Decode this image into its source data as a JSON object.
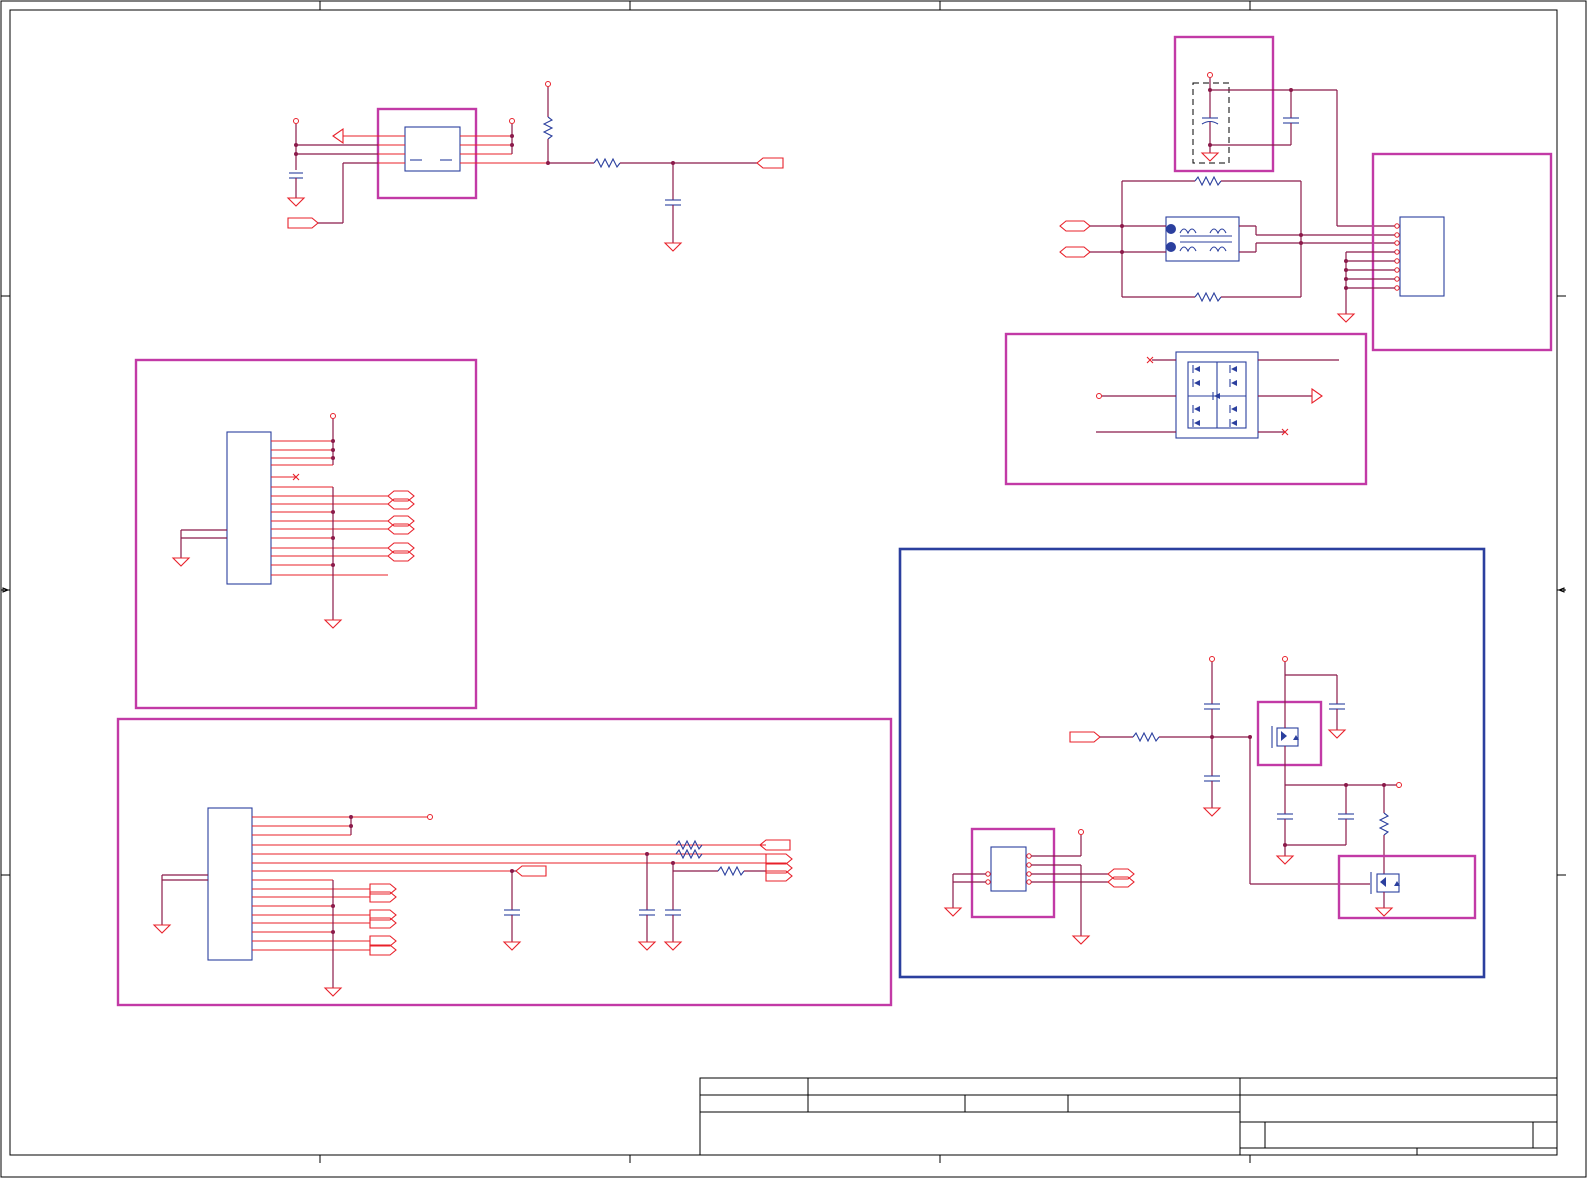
{
  "title_block": {
    "rows": 3
  }
}
